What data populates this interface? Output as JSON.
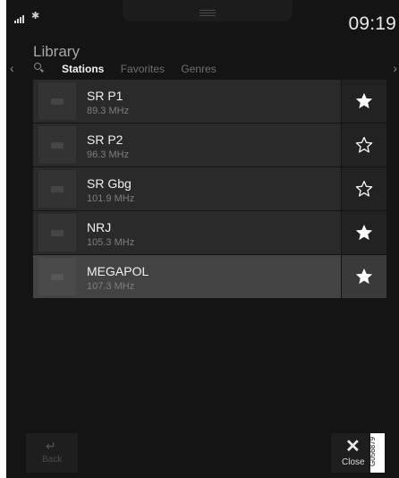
{
  "status": {
    "bluetooth_icon": "bluetooth-icon",
    "signal_icon": "signal-icon",
    "time": "09:19"
  },
  "header": {
    "title": "Library"
  },
  "tabs": [
    {
      "label": "Stations",
      "active": true
    },
    {
      "label": "Favorites",
      "active": false
    },
    {
      "label": "Genres",
      "active": false
    }
  ],
  "stations": [
    {
      "name": "SR P1",
      "freq": "89.3 MHz",
      "favorite": true,
      "selected": false
    },
    {
      "name": "SR P2",
      "freq": "96.3 MHz",
      "favorite": false,
      "selected": false
    },
    {
      "name": "SR Gbg",
      "freq": "101.9 MHz",
      "favorite": false,
      "selected": false
    },
    {
      "name": "NRJ",
      "freq": "105.3 MHz",
      "favorite": true,
      "selected": false
    },
    {
      "name": "MEGAPOL",
      "freq": "107.3 MHz",
      "favorite": true,
      "selected": true
    }
  ],
  "footer": {
    "back_label": "Back",
    "close_label": "Close"
  },
  "figure_code": "G056879",
  "colors": {
    "background": "#141414",
    "row": "#2a2a2a",
    "row_selected": "#434343",
    "text": "#f0f0f0"
  }
}
